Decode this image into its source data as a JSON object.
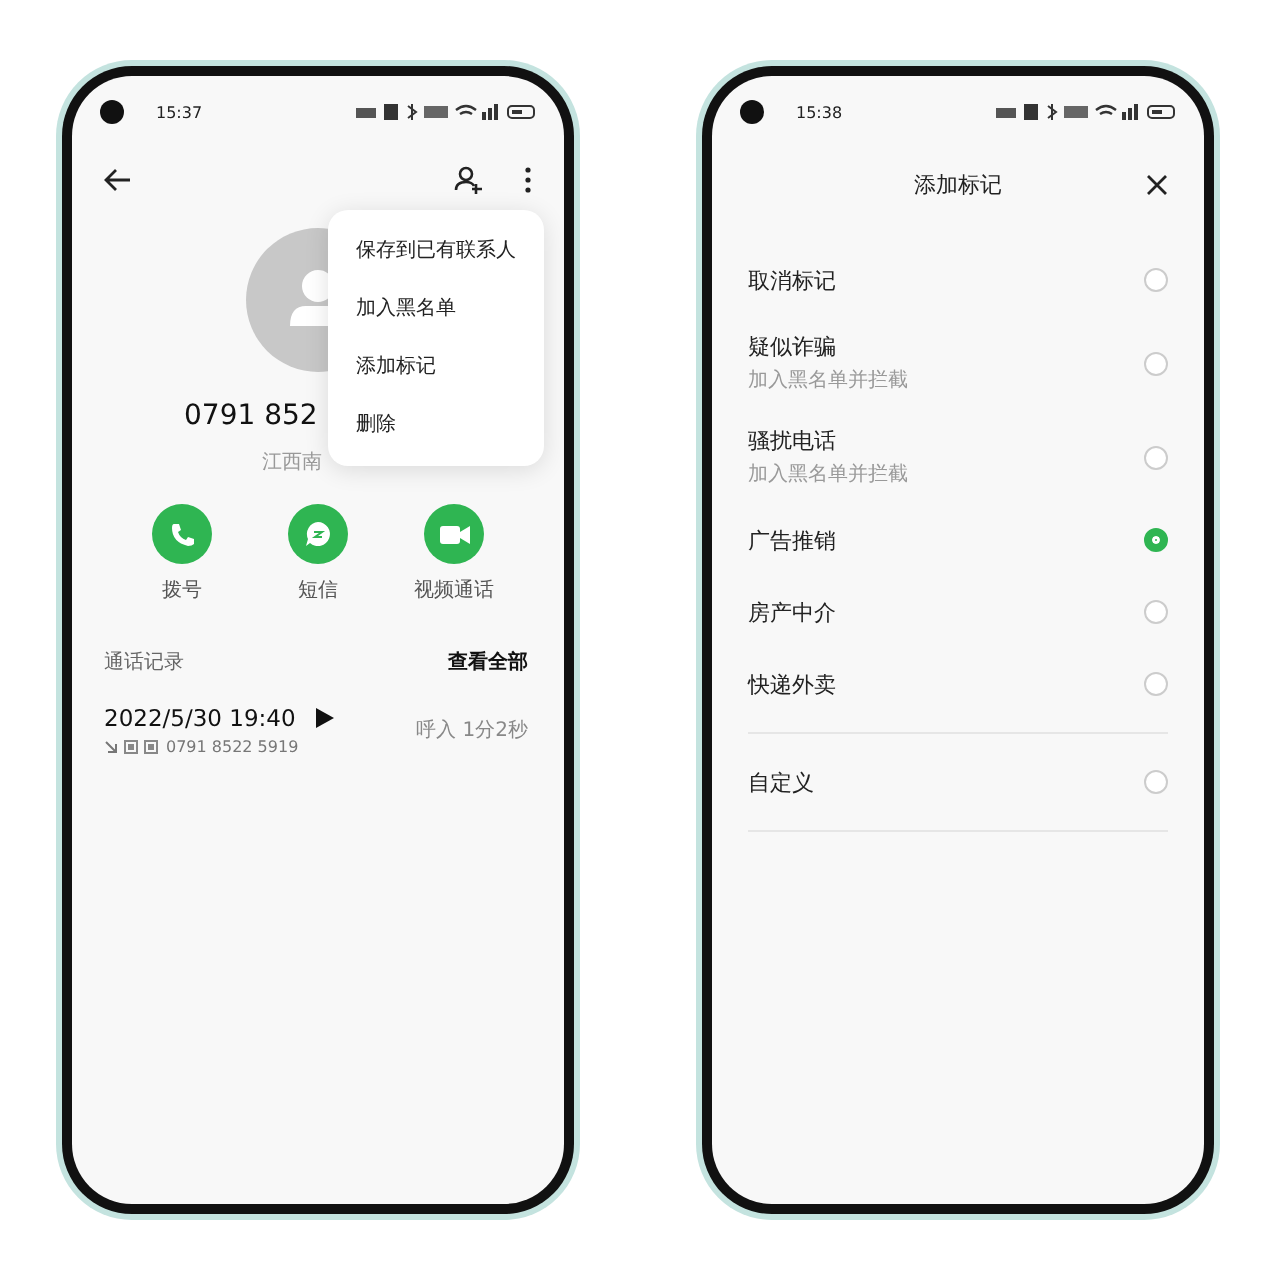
{
  "call_detail_screen": {
    "status_time": "15:37",
    "number_visible": "0791 852",
    "location_visible": "江西南",
    "menu": [
      {
        "label": "保存到已有联系人"
      },
      {
        "label": "加入黑名单"
      },
      {
        "label": "添加标记"
      },
      {
        "label": "删除"
      }
    ],
    "actions": [
      {
        "kind": "call",
        "label": "拨号"
      },
      {
        "kind": "message",
        "label": "短信"
      },
      {
        "kind": "video",
        "label": "视频通话"
      }
    ],
    "history_title": "通话记录",
    "view_all": "查看全部",
    "calls": [
      {
        "datetime": "2022/5/30 19:40",
        "number": "0791 8522 5919",
        "info": "呼入 1分2秒"
      }
    ]
  },
  "mark_screen": {
    "status_time": "15:38",
    "title": "添加标记",
    "options": [
      {
        "label": "取消标记",
        "selected": false
      },
      {
        "label": "疑似诈骗",
        "subtitle": "加入黑名单并拦截",
        "selected": false
      },
      {
        "label": "骚扰电话",
        "subtitle": "加入黑名单并拦截",
        "selected": false
      },
      {
        "label": "广告推销",
        "selected": true
      },
      {
        "label": "房产中介",
        "selected": false
      },
      {
        "label": "快递外卖",
        "selected": false
      }
    ],
    "custom": {
      "label": "自定义",
      "selected": false
    }
  }
}
